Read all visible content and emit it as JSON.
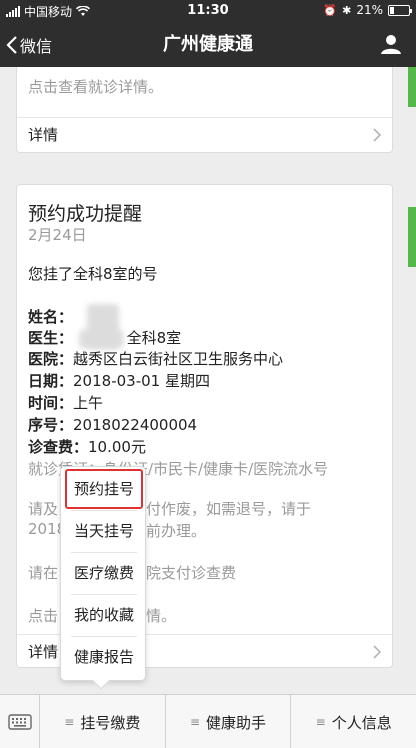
{
  "status_bar": {
    "carrier": "中国移动",
    "time": "11:30",
    "battery": "21%",
    "battery_level": 0.21
  },
  "nav": {
    "back_label": "微信",
    "title": "广州健康通"
  },
  "card1": {
    "hint": "点击查看就诊详情。",
    "detail_label": "详情"
  },
  "card2": {
    "title": "预约成功提醒",
    "date": "2月24日",
    "intro": "您挂了全科8室的号",
    "name_label": "姓名：",
    "doctor_label": "医生：",
    "doctor_value": "全科8室",
    "hospital_label": "医院：",
    "hospital_value": "越秀区白云街社区卫生服务中心",
    "date_label": "日期：",
    "date_value": "2018-03-01 星期四",
    "time_label": "时间：",
    "time_value": "上午",
    "serial_label": "序号：",
    "serial_value": "2018022400004",
    "fee_label": "诊查费：",
    "fee_value": "10.00元",
    "credentials": "就诊凭证：身份证/市民卡/健康卡/医院流水号",
    "note1_a": "请及",
    "note1_b": "付作废，如需退号，请于",
    "note2_a": "2018",
    "note2_b": "前办理。",
    "note3_a": "请在",
    "note3_b": "院支付诊查费",
    "hint_a": "点击",
    "hint_b": "情。",
    "detail_label": "详情"
  },
  "popup_menu": {
    "items": [
      "预约挂号",
      "当天挂号",
      "医疗缴费",
      "我的收藏",
      "健康报告"
    ]
  },
  "tabbar": {
    "tabs": [
      "挂号缴费",
      "健康助手",
      "个人信息"
    ]
  },
  "colors": {
    "header_bg": "#2e2e2e",
    "highlight_border": "#e03131",
    "side_strip": "#56b84a"
  }
}
